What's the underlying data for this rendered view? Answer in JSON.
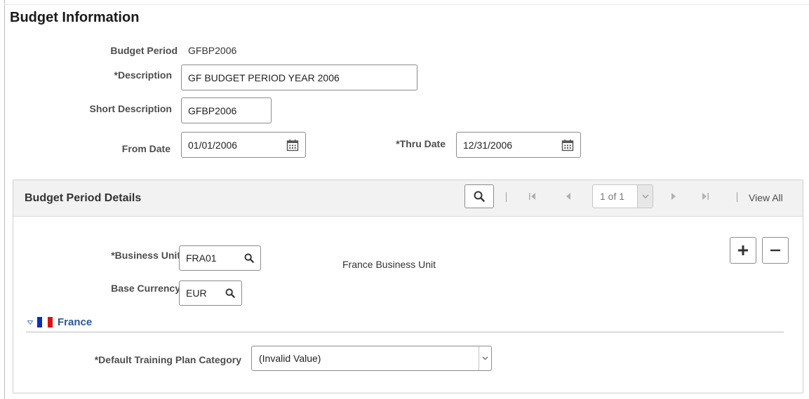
{
  "page": {
    "title": "Budget Information"
  },
  "form": {
    "budget_period": {
      "label": "Budget Period",
      "value": "GFBP2006"
    },
    "description": {
      "label": "*Description",
      "value": "GF BUDGET PERIOD YEAR 2006"
    },
    "short_description": {
      "label": "Short Description",
      "value": "GFBP2006"
    },
    "from_date": {
      "label": "From Date",
      "value": "01/01/2006",
      "icon": "calendar-icon"
    },
    "thru_date": {
      "label": "*Thru Date",
      "value": "12/31/2006",
      "icon": "calendar-icon"
    }
  },
  "details": {
    "title": "Budget Period Details",
    "pager": {
      "text": "1 of 1",
      "view_all": "View All"
    },
    "business_unit": {
      "label": "*Business Unit",
      "value": "FRA01",
      "description": "France Business Unit",
      "icon": "search-icon"
    },
    "base_currency": {
      "label": "Base Currency",
      "value": "EUR",
      "icon": "search-icon"
    },
    "group": {
      "label": "France",
      "flag_colors": [
        "#0b2db8",
        "#ffffff",
        "#e01010"
      ]
    },
    "training_category": {
      "label": "*Default Training Plan Category",
      "value": "(Invalid Value)"
    }
  },
  "colors": {
    "link": "#2b5796",
    "header_bg": "#f2f2f2",
    "border": "#8c8c8c"
  }
}
